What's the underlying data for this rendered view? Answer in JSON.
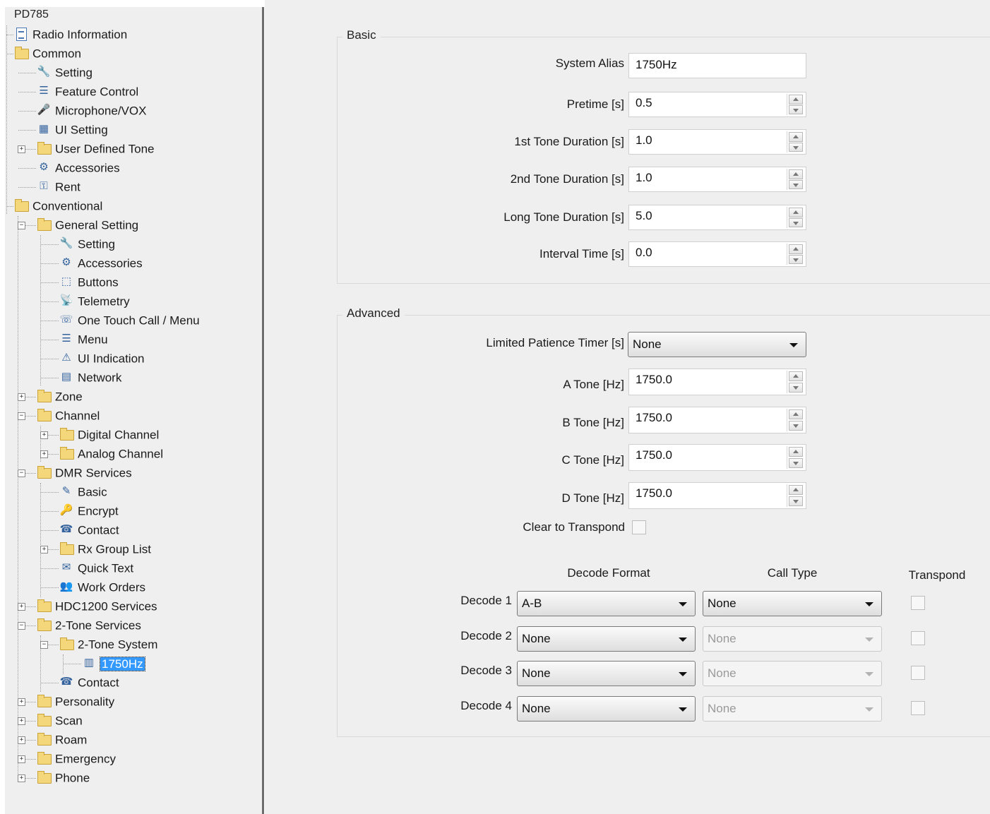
{
  "tree": {
    "root": "PD785",
    "items": [
      {
        "label": "Radio Information",
        "icon": "document-icon",
        "glyph": "",
        "selected": false
      },
      {
        "label": "Common",
        "icon": "folder-open-icon",
        "glyph": "",
        "selected": false
      },
      {
        "label": "Setting",
        "icon": "wrench-icon",
        "glyph": "🔧",
        "selected": false
      },
      {
        "label": "Feature Control",
        "icon": "list-icon",
        "glyph": "☰",
        "selected": false
      },
      {
        "label": "Microphone/VOX",
        "icon": "microphone-icon",
        "glyph": "🎤",
        "selected": false
      },
      {
        "label": "UI Setting",
        "icon": "ui-setting-icon",
        "glyph": "▦",
        "selected": false
      },
      {
        "label": "User Defined Tone",
        "icon": "folder-icon",
        "glyph": "",
        "selected": false
      },
      {
        "label": "Accessories",
        "icon": "accessories-icon",
        "glyph": "⚙",
        "selected": false
      },
      {
        "label": "Rent",
        "icon": "rent-icon",
        "glyph": "⚿",
        "selected": false
      },
      {
        "label": "Conventional",
        "icon": "folder-open-icon",
        "glyph": "",
        "selected": false
      },
      {
        "label": "General Setting",
        "icon": "folder-open-icon",
        "glyph": "",
        "selected": false
      },
      {
        "label": "Setting",
        "icon": "wrench-icon",
        "glyph": "🔧",
        "selected": false
      },
      {
        "label": "Accessories",
        "icon": "accessories-icon",
        "glyph": "⚙",
        "selected": false
      },
      {
        "label": "Buttons",
        "icon": "buttons-icon",
        "glyph": "⬚",
        "selected": false
      },
      {
        "label": "Telemetry",
        "icon": "telemetry-icon",
        "glyph": "📡",
        "selected": false
      },
      {
        "label": "One Touch Call / Menu",
        "icon": "one-touch-call-icon",
        "glyph": "☏",
        "selected": false
      },
      {
        "label": "Menu",
        "icon": "menu-icon",
        "glyph": "☰",
        "selected": false
      },
      {
        "label": "UI Indication",
        "icon": "ui-indication-icon",
        "glyph": "⚠",
        "selected": false
      },
      {
        "label": "Network",
        "icon": "network-icon",
        "glyph": "▤",
        "selected": false
      },
      {
        "label": "Zone",
        "icon": "folder-icon",
        "glyph": "",
        "selected": false
      },
      {
        "label": "Channel",
        "icon": "folder-open-icon",
        "glyph": "",
        "selected": false
      },
      {
        "label": "Digital Channel",
        "icon": "folder-icon",
        "glyph": "",
        "selected": false
      },
      {
        "label": "Analog Channel",
        "icon": "folder-icon",
        "glyph": "",
        "selected": false
      },
      {
        "label": "DMR Services",
        "icon": "folder-open-icon",
        "glyph": "",
        "selected": false
      },
      {
        "label": "Basic",
        "icon": "basic-icon",
        "glyph": "✎",
        "selected": false
      },
      {
        "label": "Encrypt",
        "icon": "encrypt-icon",
        "glyph": "🔑",
        "selected": false
      },
      {
        "label": "Contact",
        "icon": "contact-icon",
        "glyph": "☎",
        "selected": false
      },
      {
        "label": "Rx Group List",
        "icon": "folder-icon",
        "glyph": "",
        "selected": false
      },
      {
        "label": "Quick Text",
        "icon": "quick-text-icon",
        "glyph": "✉",
        "selected": false
      },
      {
        "label": "Work Orders",
        "icon": "work-orders-icon",
        "glyph": "👥",
        "selected": false
      },
      {
        "label": "HDC1200 Services",
        "icon": "folder-icon",
        "glyph": "",
        "selected": false
      },
      {
        "label": "2-Tone Services",
        "icon": "folder-open-icon",
        "glyph": "",
        "selected": false
      },
      {
        "label": "2-Tone System",
        "icon": "folder-open-icon",
        "glyph": "",
        "selected": false
      },
      {
        "label": "1750Hz",
        "icon": "tone-system-icon",
        "glyph": "▥",
        "selected": true
      },
      {
        "label": "Contact",
        "icon": "contact-icon",
        "glyph": "☎",
        "selected": false
      },
      {
        "label": "Personality",
        "icon": "folder-icon",
        "glyph": "",
        "selected": false
      },
      {
        "label": "Scan",
        "icon": "folder-icon",
        "glyph": "",
        "selected": false
      },
      {
        "label": "Roam",
        "icon": "folder-icon",
        "glyph": "",
        "selected": false
      },
      {
        "label": "Emergency",
        "icon": "folder-icon",
        "glyph": "",
        "selected": false
      },
      {
        "label": "Phone",
        "icon": "folder-icon",
        "glyph": "",
        "selected": false
      }
    ]
  },
  "basic": {
    "title": "Basic",
    "system_alias_label": "System Alias",
    "system_alias_value": "1750Hz",
    "fields": [
      {
        "label": "Pretime [s]",
        "value": "0.5"
      },
      {
        "label": "1st Tone Duration [s]",
        "value": "1.0"
      },
      {
        "label": "2nd Tone Duration [s]",
        "value": "1.0"
      },
      {
        "label": "Long Tone Duration [s]",
        "value": "5.0"
      },
      {
        "label": "Interval Time [s]",
        "value": "0.0"
      }
    ]
  },
  "advanced": {
    "title": "Advanced",
    "patience_label": "Limited Patience Timer [s]",
    "patience_value": "None",
    "tones": [
      {
        "label": "A Tone [Hz]",
        "value": "1750.0"
      },
      {
        "label": "B Tone [Hz]",
        "value": "1750.0"
      },
      {
        "label": "C Tone [Hz]",
        "value": "1750.0"
      },
      {
        "label": "D Tone [Hz]",
        "value": "1750.0"
      }
    ],
    "clear_label": "Clear to Transpond",
    "headers": {
      "format": "Decode Format",
      "call_type": "Call Type",
      "transpond": "Transpond"
    },
    "decodes": [
      {
        "label": "Decode 1",
        "format": "A-B",
        "call_type": "None"
      },
      {
        "label": "Decode 2",
        "format": "None",
        "call_type": "None"
      },
      {
        "label": "Decode 3",
        "format": "None",
        "call_type": "None"
      },
      {
        "label": "Decode 4",
        "format": "None",
        "call_type": "None"
      }
    ]
  }
}
